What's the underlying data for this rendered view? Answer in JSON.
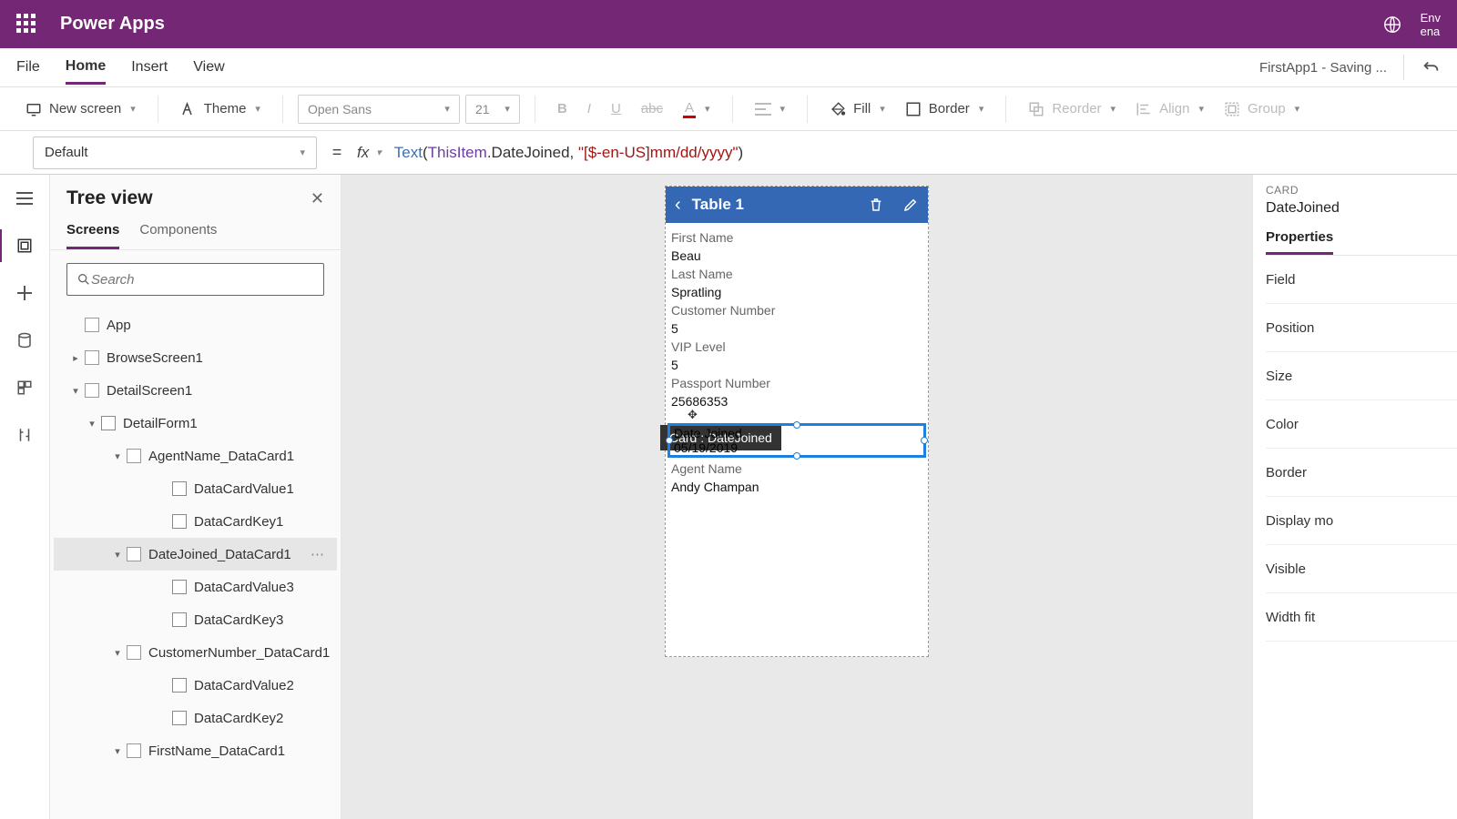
{
  "titlebar": {
    "app_name": "Power Apps",
    "env_label": "Env",
    "env_value": "ena"
  },
  "menu": {
    "items": [
      "File",
      "Home",
      "Insert",
      "View"
    ],
    "active": "Home",
    "file_status": "FirstApp1 - Saving ..."
  },
  "ribbon": {
    "new_screen": "New screen",
    "theme": "Theme",
    "font": "Open Sans",
    "size": "21",
    "fill": "Fill",
    "border": "Border",
    "reorder": "Reorder",
    "align": "Align",
    "group": "Group"
  },
  "formula": {
    "property": "Default",
    "fx": "fx",
    "expr_fn": "Text",
    "expr_obj": "ThisItem",
    "expr_field": ".DateJoined, ",
    "expr_str": "\"[$-en-US]mm/dd/yyyy\"",
    "full": "Text(ThisItem.DateJoined, \"[$-en-US]mm/dd/yyyy\")"
  },
  "tree": {
    "title": "Tree view",
    "tabs": [
      "Screens",
      "Components"
    ],
    "active_tab": "Screens",
    "search_placeholder": "Search",
    "nodes": {
      "app": "App",
      "browse": "BrowseScreen1",
      "detail": "DetailScreen1",
      "detailform": "DetailForm1",
      "agent_dc": "AgentName_DataCard1",
      "agent_val": "DataCardValue1",
      "agent_key": "DataCardKey1",
      "date_dc": "DateJoined_DataCard1",
      "date_val": "DataCardValue3",
      "date_key": "DataCardKey3",
      "cust_dc": "CustomerNumber_DataCard1",
      "cust_val": "DataCardValue2",
      "cust_key": "DataCardKey2",
      "fname_dc": "FirstName_DataCard1"
    }
  },
  "canvas": {
    "header_title": "Table 1",
    "tooltip": "Card : DateJoined",
    "cards": [
      {
        "label": "First Name",
        "value": "Beau"
      },
      {
        "label": "Last Name",
        "value": "Spratling"
      },
      {
        "label": "Customer Number",
        "value": "5"
      },
      {
        "label": "VIP Level",
        "value": "5"
      },
      {
        "label": "Passport Number",
        "value": "25686353"
      }
    ],
    "selected_card": {
      "label": "Date Joined",
      "value": "05/19/2019"
    },
    "after_cards": [
      {
        "label": "Agent Name",
        "value": "Andy Champan"
      }
    ]
  },
  "props": {
    "category": "CARD",
    "name": "DateJoined",
    "tabs": [
      "Properties"
    ],
    "rows": [
      "Field",
      "Position",
      "Size",
      "Color",
      "Border",
      "Display mo",
      "Visible",
      "Width fit"
    ]
  }
}
